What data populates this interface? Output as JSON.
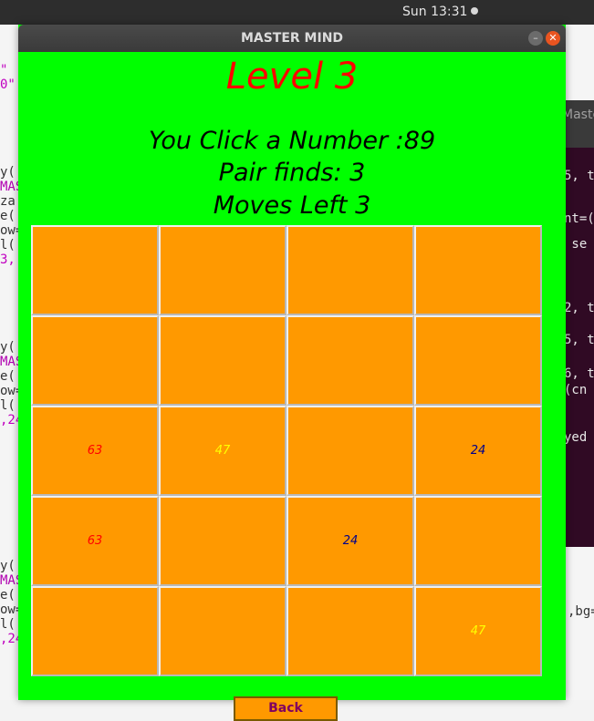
{
  "system": {
    "clock": "Sun 13:31"
  },
  "editor": {
    "left_lines": [
      "\"",
      "0\"",
      "",
      "",
      "",
      "",
      "",
      "y(",
      "MAS",
      "za",
      "e(",
      "ow=",
      "l(",
      "3,",
      "",
      "",
      "",
      "",
      "",
      "y(",
      "MAS",
      "e(",
      "ow=",
      "l(",
      ",24",
      "",
      "",
      "",
      "",
      "",
      "",
      "",
      "",
      "",
      "y(",
      "MAS",
      "e(",
      "ow=",
      "l(",
      ",24"
    ],
    "right_text": ",bg="
  },
  "terminal": {
    "tab_label": "Maste",
    "lines": [
      "5, t",
      "nt=(",
      " se",
      "2, t",
      "5, t",
      "6, t",
      "(cn",
      "yed"
    ]
  },
  "window": {
    "title": "MASTER MIND",
    "minimize_glyph": "–",
    "close_glyph": "✕"
  },
  "game": {
    "level_label": "Level 3",
    "clicked_label": "You Click a Number :89",
    "pairs_label": "Pair finds: 3",
    "moves_label": "Moves Left 3",
    "back_label": "Back",
    "colors": {
      "window_bg": "#00ff00",
      "tile": "#ff9900",
      "level_text": "#ff0000"
    },
    "grid": [
      [
        {
          "text": "",
          "color": ""
        },
        {
          "text": "",
          "color": ""
        },
        {
          "text": "",
          "color": ""
        },
        {
          "text": "",
          "color": ""
        }
      ],
      [
        {
          "text": "",
          "color": ""
        },
        {
          "text": "",
          "color": ""
        },
        {
          "text": "",
          "color": ""
        },
        {
          "text": "",
          "color": ""
        }
      ],
      [
        {
          "text": "63",
          "color": "#ff0000"
        },
        {
          "text": "47",
          "color": "#ffff00"
        },
        {
          "text": "",
          "color": ""
        },
        {
          "text": "24",
          "color": "#00008b"
        }
      ],
      [
        {
          "text": "63",
          "color": "#ff0000"
        },
        {
          "text": "",
          "color": ""
        },
        {
          "text": "24",
          "color": "#00008b"
        },
        {
          "text": "",
          "color": ""
        }
      ],
      [
        {
          "text": "",
          "color": ""
        },
        {
          "text": "",
          "color": ""
        },
        {
          "text": "",
          "color": ""
        },
        {
          "text": "47",
          "color": "#ffff00"
        }
      ]
    ]
  }
}
